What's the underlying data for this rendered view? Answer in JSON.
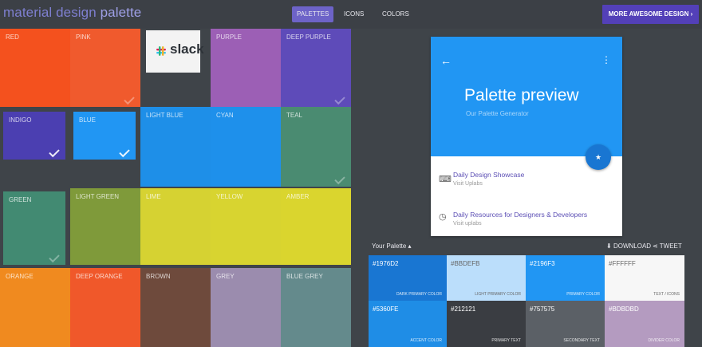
{
  "app": {
    "brand_part1": "material design",
    "brand_part2": "palette"
  },
  "nav": {
    "tabs": [
      {
        "label": "PALETTES",
        "active": true
      },
      {
        "label": "ICONS",
        "active": false
      },
      {
        "label": "COLORS",
        "active": false
      }
    ],
    "cta_label": "MORE AWESOME DESIGN ›"
  },
  "colors": {
    "red": "#f4511e",
    "pink": "#f05a2d",
    "purple": "#9c5fb5",
    "deep_purple": "#5e4bb9",
    "indigo": "#4b3fb1",
    "blue": "#2196f3",
    "light_blue": "#1e8fe8",
    "cyan": "#1e90eb",
    "teal": "#4a8b71",
    "green": "#428a72",
    "light_green": "#7f9a3a",
    "lime": "#d6d232",
    "yellow": "#d8d430",
    "amber": "#dad52e",
    "orange": "#f08a1f",
    "deep_orange": "#f0582a",
    "brown": "#6e4a3c",
    "grey": "#9b8cae",
    "blue_grey": "#648a8c",
    "accent": "#5340b8"
  },
  "palette_grid": [
    {
      "label": "RED",
      "color_key": "red",
      "checked": false
    },
    {
      "label": "PINK",
      "color_key": "pink",
      "checked": true
    },
    {
      "label": "PURPLE",
      "color_key": "purple",
      "checked": false
    },
    {
      "label": "DEEP PURPLE",
      "color_key": "deep_purple",
      "checked": true
    },
    {
      "label": "INDIGO",
      "color_key": "indigo",
      "checked": true
    },
    {
      "label": "BLUE",
      "color_key": "blue",
      "checked": true
    },
    {
      "label": "LIGHT BLUE",
      "color_key": "light_blue",
      "checked": false
    },
    {
      "label": "CYAN",
      "color_key": "cyan",
      "checked": false
    },
    {
      "label": "TEAL",
      "color_key": "teal",
      "checked": true
    },
    {
      "label": "GREEN",
      "color_key": "green",
      "checked": true
    },
    {
      "label": "LIGHT GREEN",
      "color_key": "light_green",
      "checked": false
    },
    {
      "label": "LIME",
      "color_key": "lime",
      "checked": false
    },
    {
      "label": "YELLOW",
      "color_key": "yellow",
      "checked": false
    },
    {
      "label": "AMBER",
      "color_key": "amber",
      "checked": false
    },
    {
      "label": "ORANGE",
      "color_key": "orange",
      "checked": false
    },
    {
      "label": "DEEP ORANGE",
      "color_key": "deep_orange",
      "checked": false
    },
    {
      "label": "BROWN",
      "color_key": "brown",
      "checked": false
    },
    {
      "label": "GREY",
      "color_key": "grey",
      "checked": false
    },
    {
      "label": "BLUE GREY",
      "color_key": "blue_grey",
      "checked": false
    }
  ],
  "sponsor": {
    "name": "slack",
    "icon": "slack-logo-icon"
  },
  "preview": {
    "title": "Palette preview",
    "subtitle": "Our Palette Generator",
    "fab_icon": "star-icon",
    "rows": [
      {
        "icon": "keyboard-icon",
        "title": "Daily Design Showcase",
        "sub": "Visit Uplabs"
      },
      {
        "icon": "clock-icon",
        "title": "Daily Resources for Designers & Developers",
        "sub": "Visit uplabs"
      }
    ]
  },
  "your_palette": {
    "title": "Your Palette ▴",
    "download_label": "DOWNLOAD",
    "tweet_label": "TWEET",
    "swatches": [
      {
        "hex": "#1976D2",
        "role": "DARK PRIMARY COLOR",
        "color": "#1976d2",
        "light": false
      },
      {
        "hex": "#BBDEFB",
        "role": "LIGHT PRIMARY COLOR",
        "color": "#bbdefb",
        "light": true
      },
      {
        "hex": "#2196F3",
        "role": "PRIMARY COLOR",
        "color": "#2196f3",
        "light": false
      },
      {
        "hex": "#FFFFFF",
        "role": "TEXT / ICONS",
        "color": "#f7f7f7",
        "light": true
      },
      {
        "hex": "#5360FE",
        "role": "ACCENT COLOR",
        "color": "#1f8de6",
        "light": false
      },
      {
        "hex": "#212121",
        "role": "PRIMARY TEXT",
        "color": "#3a3d42",
        "light": false
      },
      {
        "hex": "#757575",
        "role": "SECONDARY TEXT",
        "color": "#5b6066",
        "light": false
      },
      {
        "hex": "#BDBDBD",
        "role": "DIVIDER COLOR",
        "color": "#b49bc0",
        "light": false
      }
    ]
  }
}
